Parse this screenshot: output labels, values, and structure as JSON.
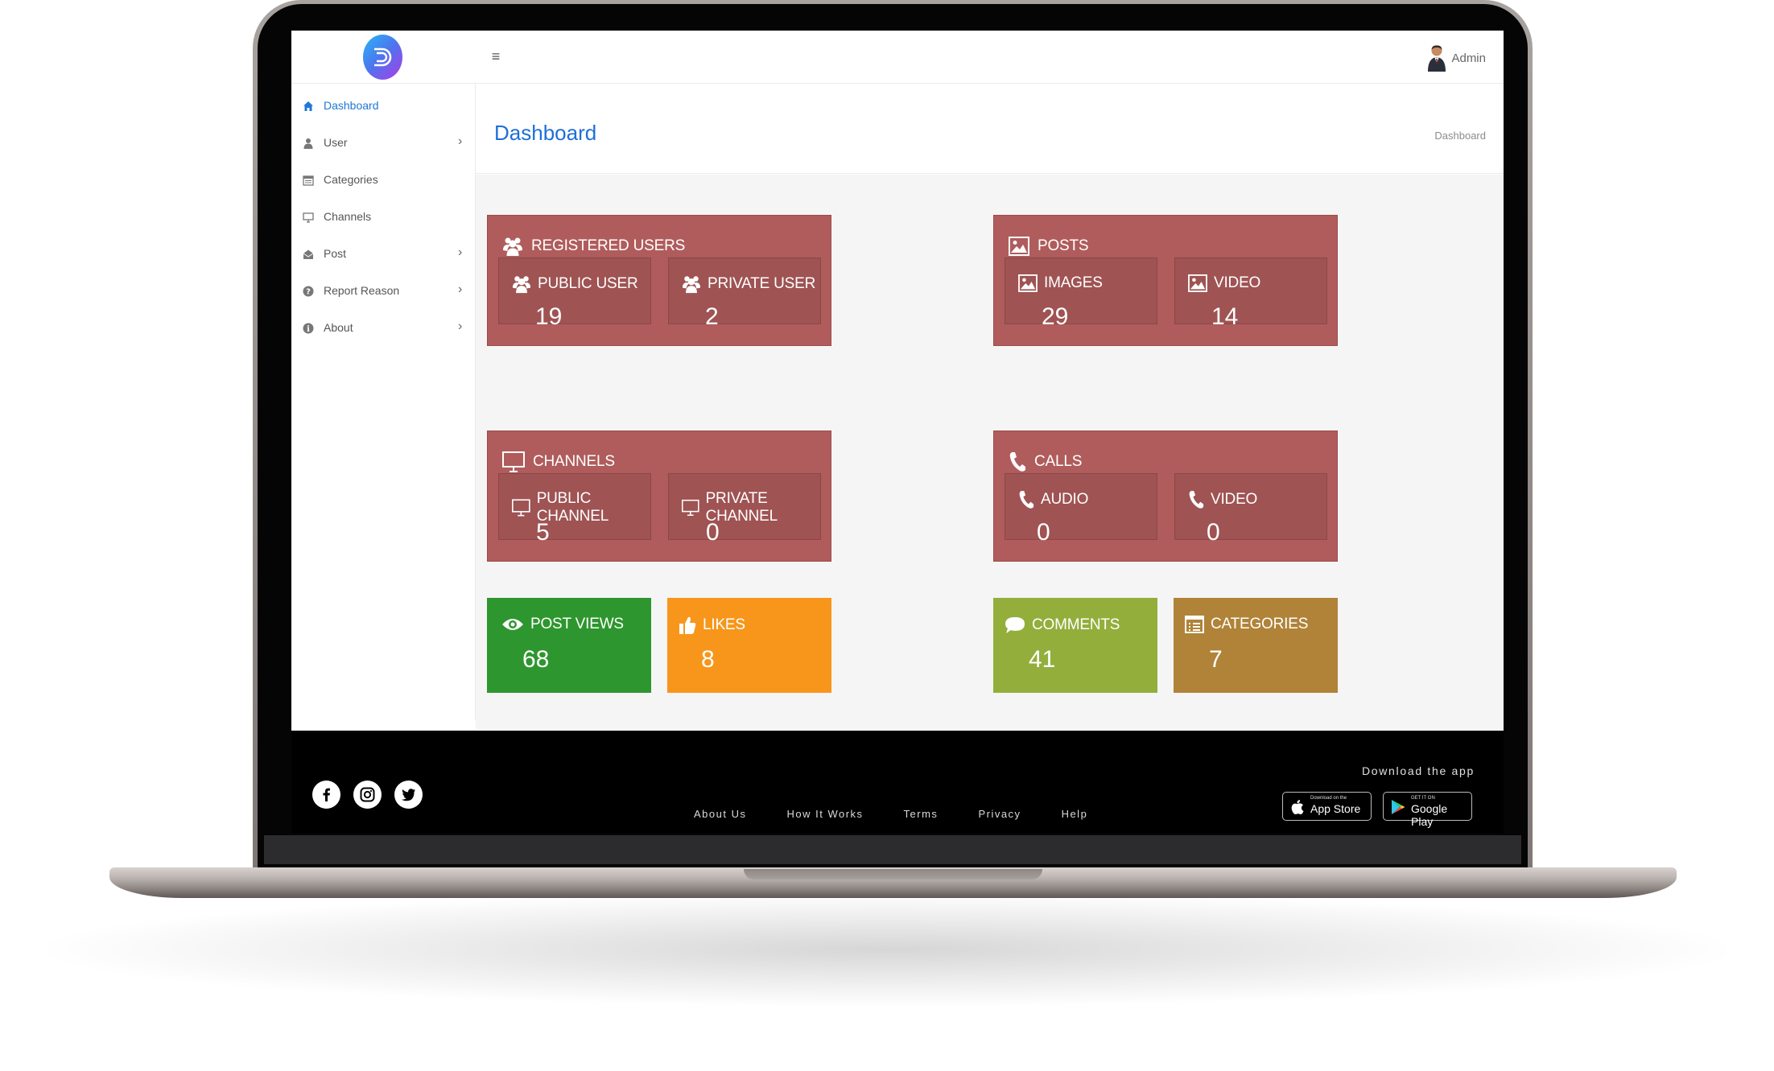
{
  "topbar": {
    "menu_glyph": "≡",
    "user_name": "Admin"
  },
  "sidebar": {
    "items": [
      {
        "label": "Dashboard",
        "icon": "home-icon",
        "active": true,
        "has_children": false
      },
      {
        "label": "User",
        "icon": "user-icon",
        "active": false,
        "has_children": true
      },
      {
        "label": "Categories",
        "icon": "calendar-icon",
        "active": false,
        "has_children": false
      },
      {
        "label": "Channels",
        "icon": "monitor-icon",
        "active": false,
        "has_children": false
      },
      {
        "label": "Post",
        "icon": "envelope-icon",
        "active": false,
        "has_children": true
      },
      {
        "label": "Report Reason",
        "icon": "question-circle-icon",
        "active": false,
        "has_children": true
      },
      {
        "label": "About",
        "icon": "info-circle-icon",
        "active": false,
        "has_children": true
      }
    ],
    "chevron": "›"
  },
  "header": {
    "title": "Dashboard",
    "breadcrumb": "Dashboard"
  },
  "cards": {
    "registered_users": {
      "title": "REGISTERED USERS",
      "public": {
        "label": "PUBLIC USER",
        "value": "19"
      },
      "private": {
        "label": "PRIVATE USER",
        "value": "2"
      }
    },
    "posts": {
      "title": "POSTS",
      "images": {
        "label": "IMAGES",
        "value": "29"
      },
      "video": {
        "label": "VIDEO",
        "value": "14"
      }
    },
    "channels": {
      "title": "CHANNELS",
      "public": {
        "label": "PUBLIC CHANNEL",
        "value": "5"
      },
      "private": {
        "label": "PRIVATE CHANNEL",
        "value": "0"
      }
    },
    "calls": {
      "title": "CALLS",
      "audio": {
        "label": "AUDIO",
        "value": "0"
      },
      "video": {
        "label": "VIDEO",
        "value": "0"
      }
    }
  },
  "stats": {
    "post_views": {
      "label": "POST VIEWS",
      "value": "68",
      "color": "#2e962e"
    },
    "likes": {
      "label": "LIKES",
      "value": "8",
      "color": "#f7961b"
    },
    "comments": {
      "label": "COMMENTS",
      "value": "41",
      "color": "#93ae3b"
    },
    "categories": {
      "label": "CATEGORIES",
      "value": "7",
      "color": "#b08338"
    }
  },
  "colors": {
    "card_bg": "#b05c5c",
    "sub_card_bg": "#9f5353",
    "accent_blue": "#1e6fd9"
  },
  "footer": {
    "links": [
      "About Us",
      "How It Works",
      "Terms",
      "Privacy",
      "Help"
    ],
    "download_label": "Download the app",
    "app_store": {
      "small": "Download on the",
      "big": "App Store"
    },
    "google_play": {
      "small": "GET IT ON",
      "big": "Google Play"
    },
    "social": [
      "facebook-icon",
      "instagram-icon",
      "twitter-icon"
    ]
  }
}
